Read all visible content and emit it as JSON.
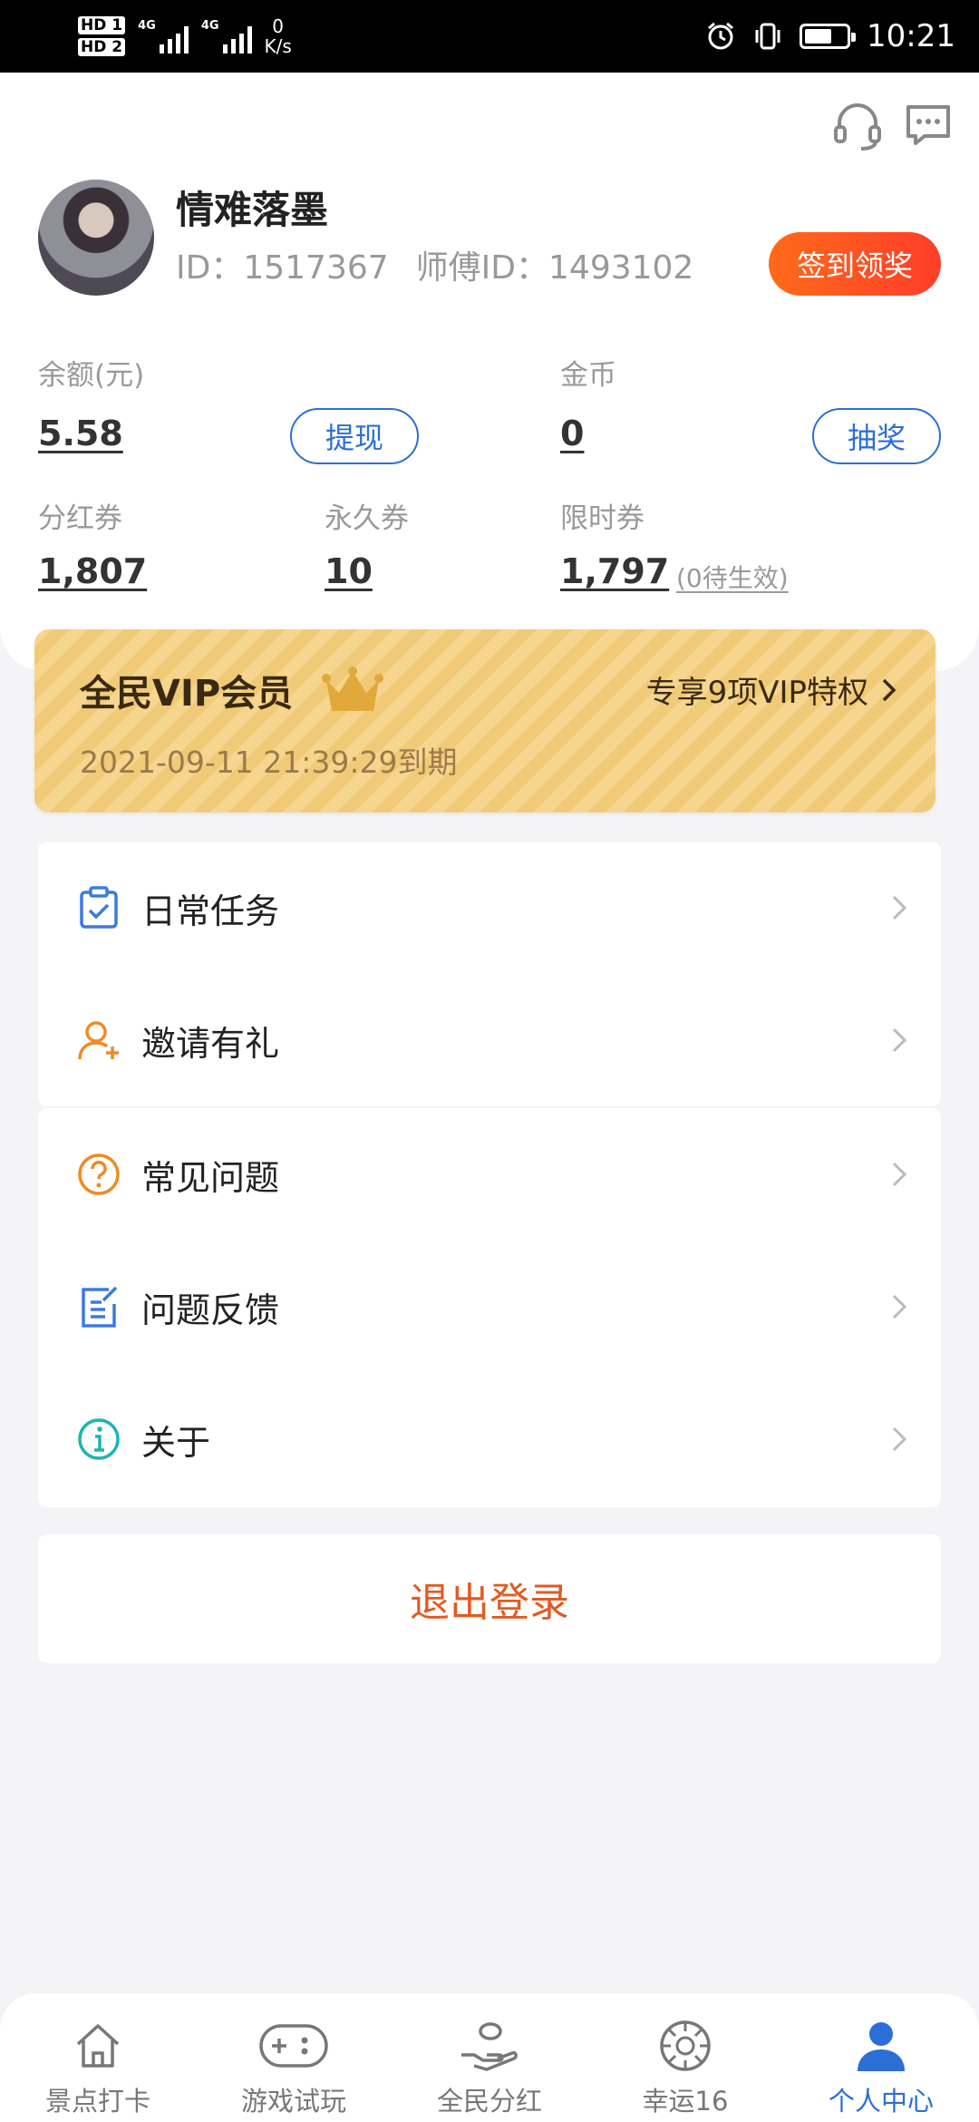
{
  "status_bar": {
    "hd1": "HD 1",
    "hd2": "HD 2",
    "net1": "4G",
    "net2": "4G",
    "speed_value": "0",
    "speed_unit": "K/s",
    "time": "10:21",
    "battery_level": 0.65,
    "icons": [
      "alarm-icon",
      "vibrate-icon",
      "battery-icon"
    ]
  },
  "header_icons": [
    "headset-icon",
    "message-icon"
  ],
  "profile": {
    "nickname": "情难落墨",
    "id_text": "ID：1517367",
    "master_id_text": "师傅ID：1493102",
    "checkin_label": "签到领奖"
  },
  "stats": {
    "balance_label": "余额(元)",
    "balance_value": "5.58",
    "withdraw_label": "提现",
    "coins_label": "金币",
    "coins_value": "0",
    "lottery_label": "抽奖",
    "dividend_label": "分红券",
    "dividend_value": "1,807",
    "permanent_label": "永久券",
    "permanent_value": "10",
    "limited_label": "限时券",
    "limited_value": "1,797",
    "pending_text": "(0待生效)"
  },
  "vip": {
    "title": "全民VIP会员",
    "link_label": "专享9项VIP特权",
    "expiry": "2021-09-11 21:39:29到期"
  },
  "menu_group1": [
    {
      "label": "日常任务",
      "icon": "clipboard-check-icon",
      "color": "#3b7ae0"
    },
    {
      "label": "邀请有礼",
      "icon": "user-add-icon",
      "color": "#f08a24"
    }
  ],
  "menu_group2": [
    {
      "label": "常见问题",
      "icon": "question-circle-icon",
      "color": "#f08a24"
    },
    {
      "label": "问题反馈",
      "icon": "feedback-edit-icon",
      "color": "#3b7ae0"
    },
    {
      "label": "关于",
      "icon": "info-circle-icon",
      "color": "#1fb4b0"
    }
  ],
  "logout_label": "退出登录",
  "bottom_nav": [
    {
      "label": "景点打卡",
      "icon": "home-icon"
    },
    {
      "label": "游戏试玩",
      "icon": "gamepad-icon"
    },
    {
      "label": "全民分红",
      "icon": "hand-coin-icon"
    },
    {
      "label": "幸运16",
      "icon": "lucky-wheel-icon"
    },
    {
      "label": "个人中心",
      "icon": "user-icon",
      "active": true
    }
  ],
  "colors": {
    "accent": "#2b6fd6",
    "checkin": "#ff4d26",
    "logout": "#e25a22",
    "vip_bg": "#f4d089"
  }
}
